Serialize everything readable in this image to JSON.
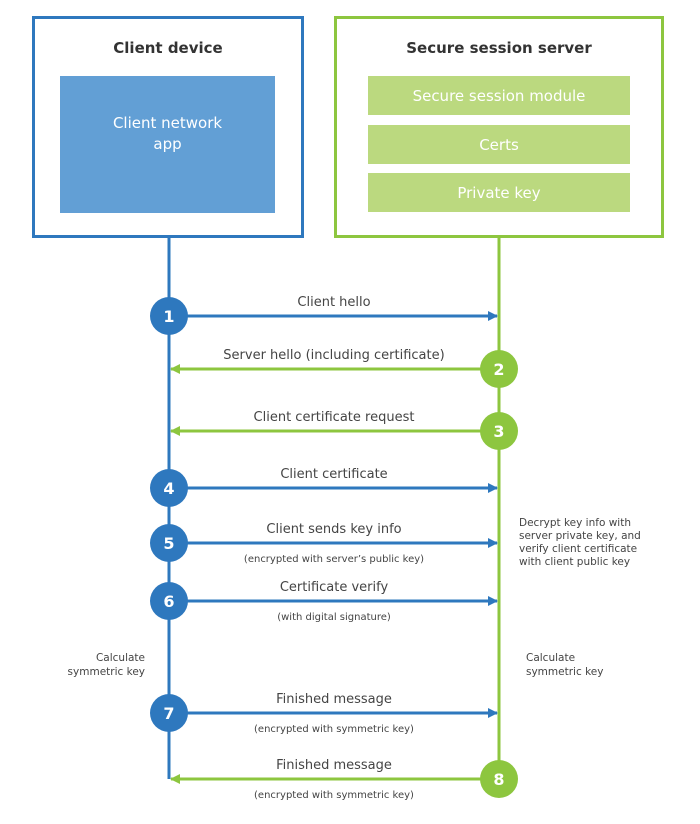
{
  "colors": {
    "client": "#2E78BE",
    "client_fill": "#629FD5",
    "server": "#8DC63F",
    "server_fill": "#BBD97F",
    "text": "#444444"
  },
  "client": {
    "title": "Client device",
    "app_label": "Client network app"
  },
  "server": {
    "title": "Secure session server",
    "components": [
      "Secure session module",
      "Certs",
      "Private key"
    ]
  },
  "steps": [
    {
      "number": "1",
      "from": "client",
      "label": "Client hello",
      "sublabel": ""
    },
    {
      "number": "2",
      "from": "server",
      "label": "Server hello (including certificate)",
      "sublabel": ""
    },
    {
      "number": "3",
      "from": "server",
      "label": "Client certificate request",
      "sublabel": ""
    },
    {
      "number": "4",
      "from": "client",
      "label": "Client certificate",
      "sublabel": ""
    },
    {
      "number": "5",
      "from": "client",
      "label": "Client sends key info",
      "sublabel": "(encrypted with server’s public key)"
    },
    {
      "number": "6",
      "from": "client",
      "label": "Certificate verify",
      "sublabel": "(with digital signature)"
    },
    {
      "number": "7",
      "from": "client",
      "label": "Finished message",
      "sublabel": "(encrypted with symmetric key)"
    },
    {
      "number": "8",
      "from": "server",
      "label": "Finished message",
      "sublabel": "(encrypted with symmetric key)"
    }
  ],
  "notes": {
    "server_decrypt": [
      "Decrypt key info with",
      "server private key, and",
      "verify client certificate",
      "with client public key"
    ],
    "client_calc": [
      "Calculate",
      "symmetric key"
    ],
    "server_calc": [
      "Calculate",
      "symmetric key"
    ]
  }
}
